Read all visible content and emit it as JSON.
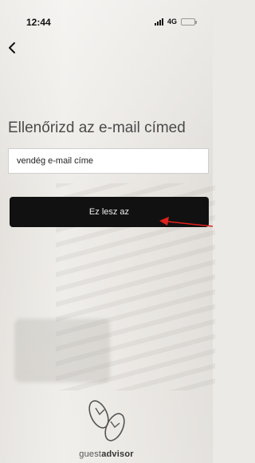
{
  "status": {
    "time": "12:44",
    "network": "4G"
  },
  "form": {
    "title": "Ellenőrizd az e-mail címed",
    "email_value": "vendég e-mail címe",
    "submit_label": "Ez lesz az"
  },
  "brand": {
    "name_light": "guest",
    "name_bold": "advisor"
  },
  "icons": {
    "back": "chevron-left-icon",
    "signal": "signal-bars-icon",
    "battery": "battery-icon",
    "logo": "flip-flops-icon"
  },
  "colors": {
    "button": "#111111",
    "battery": "#f5c400",
    "annotation_arrow": "#e0221e"
  }
}
